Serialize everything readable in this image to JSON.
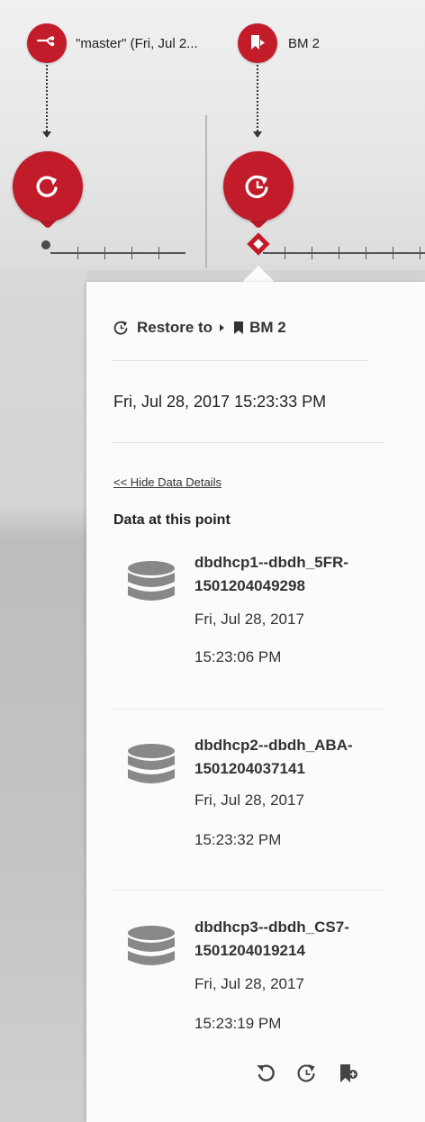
{
  "timeline": {
    "branch_label": "\"master\" (Fri, Jul 2...",
    "bookmark_label": "BM 2"
  },
  "panel": {
    "restore_label": "Restore to",
    "bookmark_name": "BM 2",
    "timestamp": "Fri, Jul 28, 2017 15:23:33 PM",
    "hide_details_link": "<< Hide Data Details",
    "data_heading": "Data at this point",
    "datasets": [
      {
        "name_line1": "dbdhcp1--dbdh_5FR-",
        "name_line2": "1501204049298",
        "date": "Fri, Jul 28, 2017",
        "time": "15:23:06 PM"
      },
      {
        "name_line1": "dbdhcp2--dbdh_ABA-",
        "name_line2": "1501204037141",
        "date": "Fri, Jul 28, 2017",
        "time": "15:23:32 PM"
      },
      {
        "name_line1": "dbdhcp3--dbdh_CS7-",
        "name_line2": "1501204019214",
        "date": "Fri, Jul 28, 2017",
        "time": "15:23:19 PM"
      }
    ],
    "actions": [
      "undo-icon",
      "restore-clock-icon",
      "bookmark-add-icon"
    ]
  },
  "colors": {
    "accent": "#c21b2a",
    "panel_bg": "#fbfbfb",
    "text": "#333333"
  }
}
